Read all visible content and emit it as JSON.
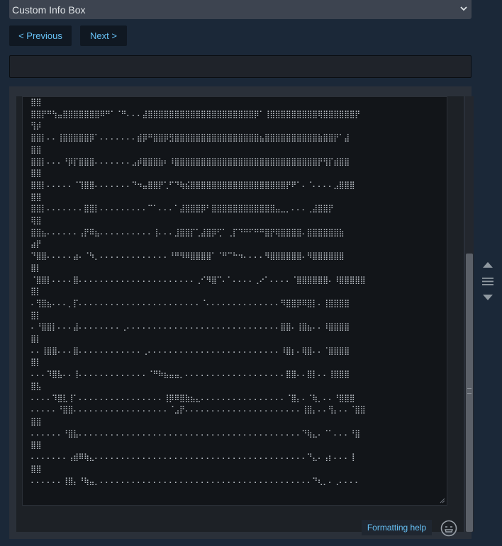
{
  "select": {
    "value": "Custom Info Box"
  },
  "nav": {
    "previous_label": "< Previous",
    "next_label": "Next >"
  },
  "title_input": {
    "value": ""
  },
  "editor": {
    "lines": [
      "⣿⣿",
      "⣿⣿⡟⠛⢳⣤⣿⣿⣿⣿⣿⣿⣿⠿⠛⠁⠈⠛⠄⠄⠄⣼⣿⣿⣿⣿⣿⣿⣿⣿⣿⣿⣿⣿⣿⣿⣿⣿⣿⣿⣿⣿⡿⠁⢸⣿⣿⣿⣿⣿⣿⣿⣿⣿⢿⣿⣿⣿⣿⣿⣿⡟",
      "⢻⡾",
      "⣿⣿⡇⠄⠄⢸⣿⣿⣿⣿⣿⡿⠁⠄⠄⠄⠄⠄⠄⠄⣾⡿⠛⣿⣿⡿⣻⣿⣿⣿⣿⣿⣿⣿⣿⣿⣿⣿⣿⣿⣿⣿⣿⣦⣿⣿⣿⣿⣿⣿⣿⣿⣿⣿⣷⣿⣿⡟⠁⣼",
      "⣿⣿",
      "⣿⣿⡇⠄⠄⠄⠘⡿⡏⣿⣿⣿⠄⠄⠄⠄⠄⠄⠄⣠⡾⣿⣿⣿⣷⠆⠸⣿⣿⣿⣿⣿⣿⣿⣿⣿⣿⣿⣿⣿⣿⣿⣿⣿⣿⣿⣿⣿⣿⣿⣿⣿⣿⣿⡟⢻⡏⣾⣿⣿",
      "⣿⣿",
      "⣿⣿⡇⠄⠄⠄⠄⠄⠈⢹⣿⣿⠄⠄⠄⠄⠄⠄⠄⠙⠲⣤⣿⣿⡟⢁⠋⠙⢷⣮⣿⣿⣿⣿⣿⣿⣿⣿⣿⣿⣿⣿⣿⣿⣿⣿⣿⣿⡟⠟⠁⠄⠈⠄⠄⠄⠄⣠⣿⣿⣿",
      "⣿⣿",
      "⣿⣿⡇⠄⠄⠄⠄⠄⠄⠄⣿⣿⡇⠄⠄⠄⠄⠄⠄⠄⠄⠄⠉⠁⠄⠄⠄⠁⣼⣿⣿⣿⡿⠃⣿⣿⣿⣿⣿⣿⣿⣿⣿⣿⣿⣿⣤⣀⡀⠄⠄⠄⢀⣼⣿⣿⡟",
      "⢿⣿",
      "⣿⣿⣦⠄⠄⠄⠄⠄⠄⢠⡟⠿⣦⠄⠄⠄⠄⠄⠄⠄⠄⠄⠄⢸⠄⠄⠄⣸⣿⣿⡏⢁⣼⣿⡿⢋⠁⢀⡏⠙⠛⠋⠛⠛⣿⡟⢿⣿⣿⣿⣿⠄⣿⣿⣿⣿⣿⣿⣷",
      "⣴⡟",
      "⠙⣿⣿⠄⠄⠄⠄⠄⣴⠄⠈⠳⡀⠄⠄⠄⠄⠄⠄⠄⠄⠄⠄⠄⠄⠄⠘⠛⠻⠿⣿⣿⣿⣿⠁⠈⠛⠉⠓⠲⠄⠄⠄⠄⠻⣿⣿⣿⣿⣿⣿⠄⠻⣿⣿⣿⣿⣿⣿",
      "⣿⡇",
      "⠈⣿⣿⡇⠄⠄⠄⠄⣿⠄⠄⠄⠄⠄⠄⠄⠄⠄⠄⠄⠄⠄⠄⠄⠄⠄⠄⠄⠄⠄⠄⢀⠊⠻⣿⠉⠄⠁⠄⠄⠄⠄⢀⠔⠁⠄⠄⠄⠄⠈⣿⣿⣿⣿⣿⣿⠄⠸⣿⣿⣿⣿⣿",
      "⣿⡇",
      "⠄⢻⣿⣦⠄⠄⠄⡀⡏⠄⠄⠄⠄⠄⠄⠄⠄⠄⠄⠄⠄⠄⠄⠄⠄⠄⠄⠄⠄⠄⠄⠄⠈⠄⠄⠄⠄⠄⠄⠄⠄⠄⠄⠄⠄⠄⠄⠻⣿⣿⡿⠿⣿⡇⠄⢸⣿⣿⣿⣿",
      "⣿⡇",
      "⠄⠘⣿⣿⡇⠄⠄⠄⣼⠄⠄⠄⠄⠄⠄⠄⠄⢀⠄⠄⠄⠄⠄⠄⠄⠄⠄⠄⠄⠄⠄⠄⠄⠄⠄⠄⠄⠄⠄⠄⠄⠄⠄⠄⠄⠄⠄⣿⣿⠄⢸⣿⣦⠄⠄⠸⣿⣿⣿⣿",
      "⣿⡇",
      "⠄⠄⢸⣿⣿⠄⠄⠄⣿⠄⠄⠄⠄⠄⠄⠄⠄⠄⠄⠄⠄⢀⠄⠄⠄⠄⠄⠄⠄⠄⠄⠄⠄⠄⠄⠄⠄⠄⠄⠄⠄⠄⠄⠄⠄⠄⠄⠸⣿⡆⠄⢿⣿⠄⠄⠈⣿⣿⣿⣿",
      "⣿⡇",
      "⠄⠄⠄⠹⣿⣧⠄⠄⢸⠄⠄⠄⠄⠄⠄⠄⠄⠄⠄⠄⠄⠄⠈⠛⠷⣦⣤⣤⡀⠄⠄⠄⠄⠄⠄⠄⠄⠄⠄⠄⠄⠄⠄⠄⠄⠄⠄⠄⣿⣿⠄⠄⣿⡇⠄⠄⢸⣿⣿⣿",
      "⣿⣧",
      "⠄⠄⠄⠄⠹⣿⣇⢸⠁⠄⠄⠄⠄⠄⠄⠄⠄⠄⠄⠄⠄⠄⠄⠄⠄⢸⡿⠿⣿⣷⣦⣄⠄⠄⠄⠄⠄⠄⠄⠄⠄⠄⠄⠄⠄⠄⠄⠄⠈⣿⡄⠄⠈⢷⡀⠄⠄⠘⣿⣿⣿",
      "⠄⠄⠄⠄⠄⠘⣿⣿⠄⠄⠄⠄⠄⠄⠄⠄⠄⠄⠄⠄⠄⠄⠄⠄⠄⠄⠈⣠⡟⠄⠄⠄⠄⠄⠄⠄⠄⠄⠄⠄⠄⠄⠄⠄⠄⠄⠄⠄⠄⠄⠄⢸⣿⡄⠄⠄⢻⡄⠄⠄⠈⣿⣿",
      "⣿⣿",
      "⠄⠄⠄⠄⠄⠄⠘⣿⣧⠄⠄⠄⠄⠄⠄⠄⠄⠄⠄⠄⠄⠄⠄⠄⠄⠄⠄⠄⠄⠄⠄⠄⠄⠄⠄⠄⠄⠄⠄⠄⠄⠄⠄⠄⠄⠄⠄⠄⠄⠄⠄⠙⢷⣄⠄⠈⠁⠄⠄⠄⠘⣿",
      "⣿⣿",
      "⠄⠄⠄⠄⠄⠄⠄⢠⣾⠿⢷⣄⠄⠄⠄⠄⠄⠄⠄⠄⠄⠄⠄⠄⠄⠄⠄⠄⠄⠄⠄⠄⠄⠄⠄⠄⠄⠄⠄⠄⠄⠄⠄⠄⠄⠄⠄⠄⠄⠄⠄⠄⠙⣄⠄⢠⡆⠄⠄⠄⢸",
      "⣿⣿",
      "⠄⠄⠄⠄⠄⠄⢸⣿⡄⠘⢷⣤⡀⠄⠄⠄⠄⠄⠄⠄⠄⠄⠄⠄⠄⠄⠄⠄⠄⠄⠄⠄⠄⠄⠄⠄⠄⠄⠄⠄⠄⠄⠄⠄⠄⠄⠄⠄⠄⠄⠄⠄⠄⠙⢆⡀⠄⢀⠄⠄⠄⠄"
    ]
  },
  "formatting_help_label": "Formatting help",
  "icons": {
    "select_chevron": "chevron-down-icon",
    "emoticon": "emoticon-icon",
    "scroll_up": "arrow-up-icon",
    "scroll_menu": "menu-icon",
    "scroll_down": "arrow-down-icon"
  },
  "colors": {
    "page_bg": "#1b2838",
    "link": "#67c1f5",
    "editor_bg": "#121519"
  }
}
